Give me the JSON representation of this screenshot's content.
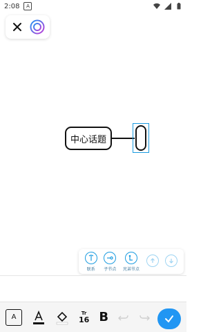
{
  "status_bar": {
    "time": "2:08",
    "notification_icon": "a-box-icon"
  },
  "top_card": {
    "close_icon": "close-icon",
    "style_icon": "target-circle-icon"
  },
  "mindmap": {
    "center_topic": "中心话题",
    "child_node_text": ""
  },
  "node_toolbar": {
    "items": [
      {
        "label": "联系",
        "icon": "link-icon"
      },
      {
        "label": "子节点",
        "icon": "add-child-icon"
      },
      {
        "label": "兄弟节点",
        "icon": "add-sibling-icon"
      },
      {
        "label": "",
        "icon": "arrow-up-icon"
      },
      {
        "label": "",
        "icon": "arrow-down-icon"
      }
    ]
  },
  "format_toolbar": {
    "textbox_label": "A",
    "font_size_top": "Tr",
    "font_size_value": "16",
    "bold_label": "B"
  },
  "colors": {
    "accent": "#1a9be0",
    "confirm": "#2196f3"
  }
}
